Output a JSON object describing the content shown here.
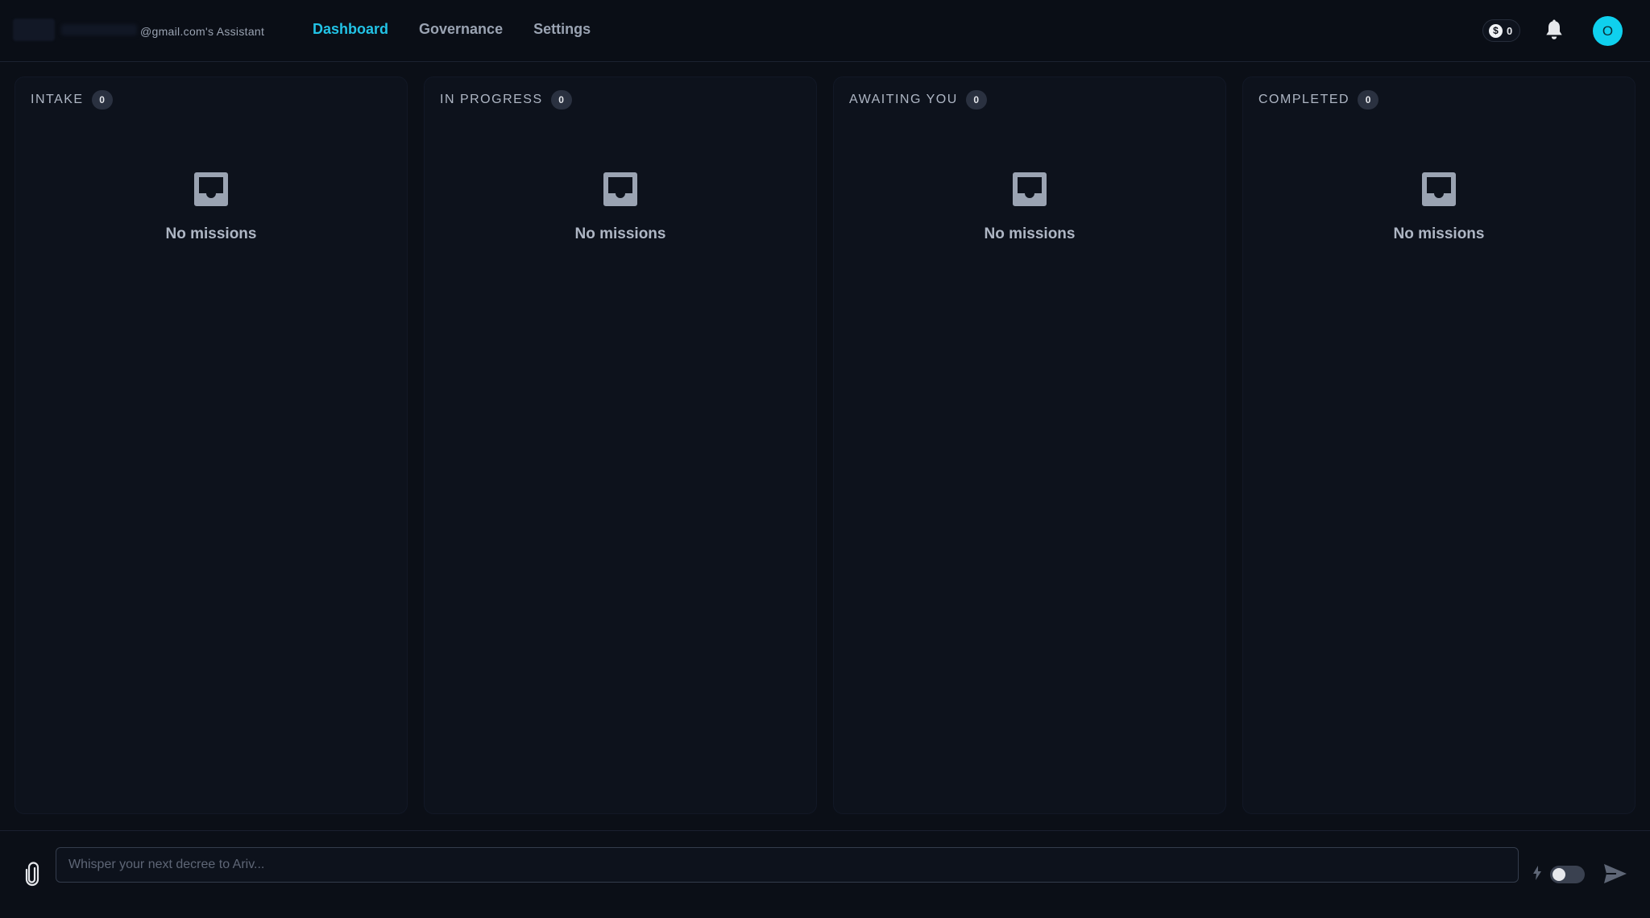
{
  "header": {
    "account_label": "@gmail.com's Assistant",
    "nav": [
      {
        "label": "Dashboard",
        "active": true
      },
      {
        "label": "Governance",
        "active": false
      },
      {
        "label": "Settings",
        "active": false
      }
    ],
    "credits": "0",
    "avatar_initial": "O"
  },
  "columns": [
    {
      "title": "INTAKE",
      "count": "0",
      "empty_text": "No missions"
    },
    {
      "title": "IN PROGRESS",
      "count": "0",
      "empty_text": "No missions"
    },
    {
      "title": "AWAITING YOU",
      "count": "0",
      "empty_text": "No missions"
    },
    {
      "title": "COMPLETED",
      "count": "0",
      "empty_text": "No missions"
    }
  ],
  "composer": {
    "placeholder": "Whisper your next decree to Ariv...",
    "value": ""
  },
  "icons": {
    "credits": "dollar-coin-icon",
    "notifications": "bell-icon",
    "empty": "inbox-tray-icon",
    "attach": "paperclip-icon",
    "mode": "bolt-icon",
    "send": "send-icon"
  },
  "colors": {
    "accent": "#22c3e6",
    "avatar": "#0fd0ee",
    "background": "#0b0f17",
    "column": "#0d121c"
  }
}
